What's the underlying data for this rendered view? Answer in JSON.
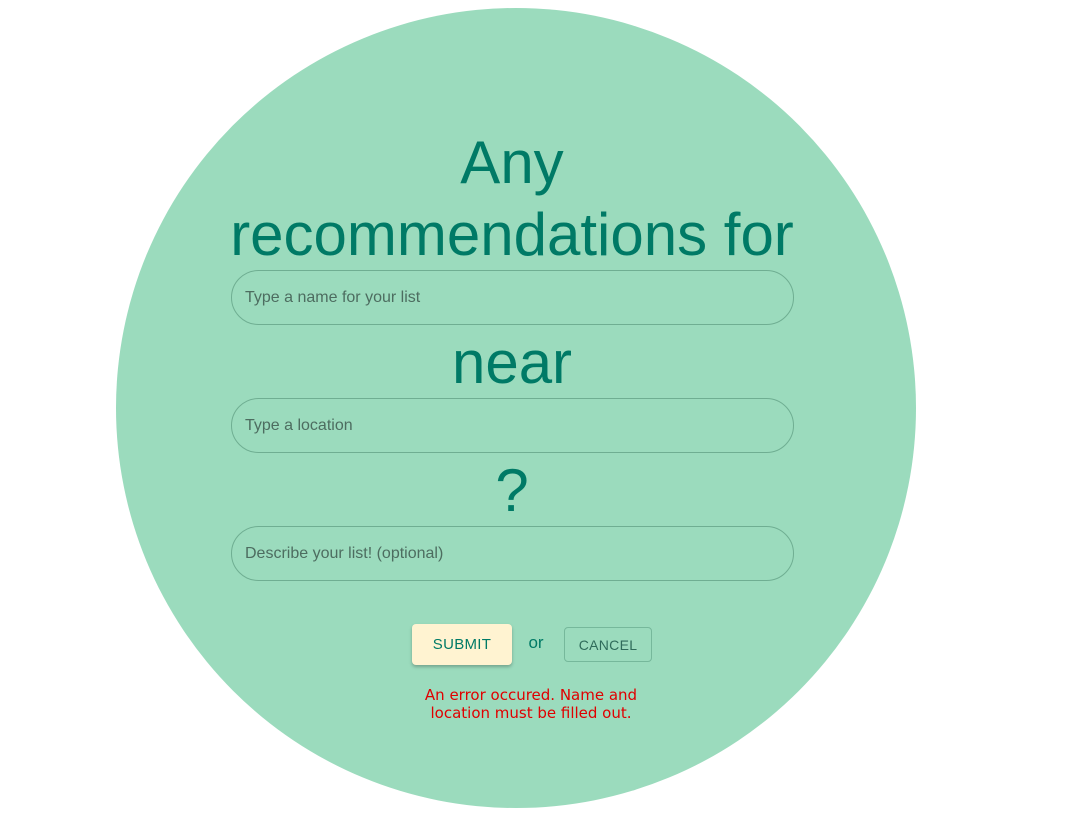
{
  "form": {
    "heading_any": "Any",
    "heading_recommendations": "recommendations for",
    "heading_near": "near",
    "heading_question": "?",
    "name_placeholder": "Type a name for your list",
    "location_placeholder": "Type a location",
    "description_placeholder": "Describe your list! (optional)"
  },
  "actions": {
    "submit_label": "SUBMIT",
    "or_label": "or",
    "cancel_label": "CANCEL"
  },
  "error_message": "An error occured. Name and location must be filled out.",
  "colors": {
    "circle_background": "#9bdbbd",
    "heading_text": "#007a66",
    "submit_background": "#fff3d1",
    "error_text": "#e00000"
  }
}
